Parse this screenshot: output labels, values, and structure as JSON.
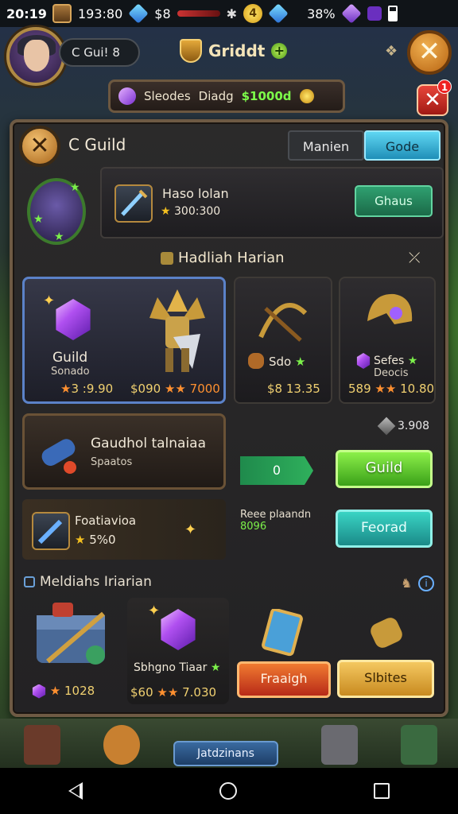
{
  "status_bar": {
    "time": "20:19",
    "value_1": "193:80",
    "value_2": "$8",
    "coin_badge": "4",
    "value_3": "38%"
  },
  "header": {
    "profile_tag": "C Gui! 8",
    "title": "Griddt",
    "resources": {
      "label_1": "Sleodes",
      "label_2": "Diadg",
      "amount": "$1000d"
    }
  },
  "panel": {
    "title": "C Guild",
    "tabs": [
      "Manien",
      "Gode"
    ],
    "profile": {
      "name": "Haso lolan",
      "rank": "300:300",
      "button": "Ghaus"
    },
    "section_title": "Hadliah Harian",
    "cards": [
      {
        "label": "Guild",
        "sub": "Sonado",
        "price_left": "3 :9.90",
        "price_right": "$090",
        "price_right2": "7000"
      },
      {
        "label": "Sdo",
        "price": "$8",
        "price2": "13.35"
      },
      {
        "label": "Sefes",
        "sub": "Deocis",
        "price": "589",
        "price2": "10.80"
      }
    ],
    "offer": {
      "title": "Gaudhol talnaiaa",
      "sub": "Spaatos",
      "side_value": "3.908",
      "qty": "0",
      "button": "Guild"
    },
    "row2": {
      "title": "Foatiavioa",
      "sub": "5%0",
      "mid_title": "Reee plaandn",
      "mid_value": "8096",
      "button": "Feorad"
    },
    "bottom": {
      "title": "Meldiahs Iriarian",
      "chest_price": "1028",
      "gem_label": "Sbhgno Tiaar",
      "gem_price_left": "$60",
      "gem_price_right": "7.030",
      "button_red": "Fraaigh",
      "button_gold": "Slbites"
    }
  },
  "bottom_bar": {
    "pill": "Jatdzinans"
  }
}
